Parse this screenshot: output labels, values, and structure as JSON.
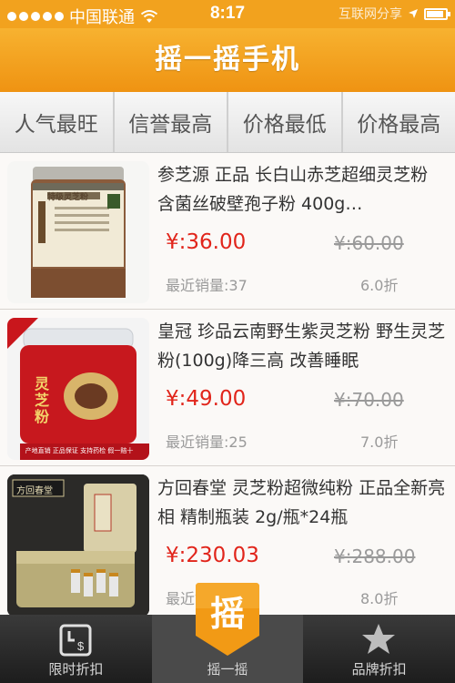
{
  "status_bar": {
    "carrier": "中国联通",
    "time": "8:17",
    "watermark": "互联网分享"
  },
  "header": {
    "title": "摇一摇手机"
  },
  "sort_tabs": [
    {
      "label": "人气最旺"
    },
    {
      "label": "信誉最高"
    },
    {
      "label": "价格最低"
    },
    {
      "label": "价格最高"
    }
  ],
  "products": [
    {
      "name": "参芝源 正品 长白山赤芝超细灵芝粉 含菌丝破壁孢子粉 400g…",
      "price": "¥:36.00",
      "original_price": "¥:60.00",
      "sales": "最近销量:37",
      "discount": "6.0折",
      "image_text": "特级灵芝粉"
    },
    {
      "name": "皇冠 珍品云南野生紫灵芝粉 野生灵芝粉(100g)降三高 改善睡眠",
      "price": "¥:49.00",
      "original_price": "¥:70.00",
      "sales": "最近销量:25",
      "discount": "7.0折",
      "image_text": "灵芝粉",
      "image_banner": "产地直销 正品保证 支持药检 假一赔十"
    },
    {
      "name": "方回春堂 灵芝粉超微纯粉 正品全新亮相 精制瓶装 2g/瓶*24瓶",
      "price": "¥:230.03",
      "original_price": "¥:288.00",
      "sales": "最近销量",
      "discount": "8.0折",
      "image_text": "方回春堂"
    }
  ],
  "bottom_tabs": [
    {
      "label": "限时折扣",
      "icon": "clock-dollar-icon"
    },
    {
      "label": "摇一摇",
      "icon": "shake-icon",
      "badge": "摇"
    },
    {
      "label": "品牌折扣",
      "icon": "star-icon"
    }
  ],
  "colors": {
    "accent": "#f2a21e",
    "price_red": "#e1251b"
  }
}
